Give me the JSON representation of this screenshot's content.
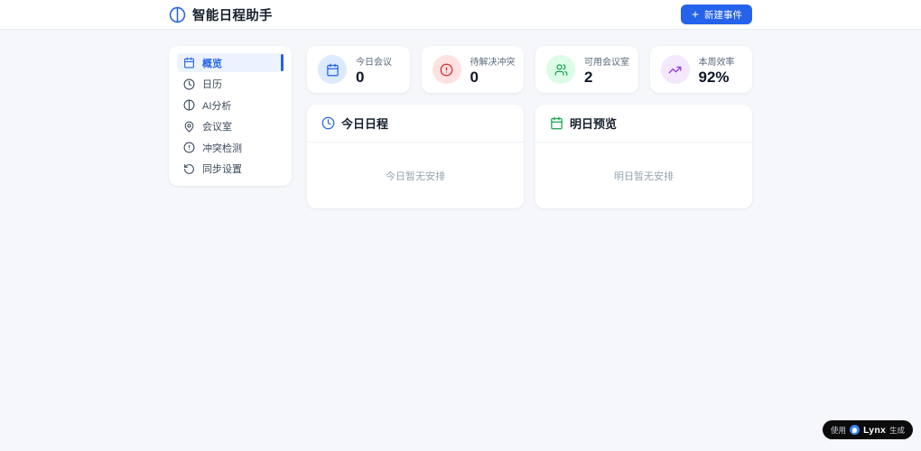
{
  "header": {
    "app_title": "智能日程助手",
    "new_event_button_label": "新建事件"
  },
  "sidebar": {
    "items": [
      {
        "label": "概览",
        "icon": "calendar-icon",
        "active": true
      },
      {
        "label": "日历",
        "icon": "clock-icon",
        "active": false
      },
      {
        "label": "AI分析",
        "icon": "ai-circle-icon",
        "active": false
      },
      {
        "label": "会议室",
        "icon": "map-pin-icon",
        "active": false
      },
      {
        "label": "冲突检测",
        "icon": "alert-circle-icon",
        "active": false
      },
      {
        "label": "同步设置",
        "icon": "sync-icon",
        "active": false
      }
    ]
  },
  "stats": [
    {
      "label": "今日会议",
      "value": "0",
      "icon": "calendar-icon",
      "icon_color": "#2563eb",
      "icon_bg": "#dbeafe"
    },
    {
      "label": "待解决冲突",
      "value": "0",
      "icon": "alert-circle-icon",
      "icon_color": "#dc2626",
      "icon_bg": "#fee2e2"
    },
    {
      "label": "可用会议室",
      "value": "2",
      "icon": "users-icon",
      "icon_color": "#16a34a",
      "icon_bg": "#dcfce7"
    },
    {
      "label": "本周效率",
      "value": "92%",
      "icon": "trending-up-icon",
      "icon_color": "#9333ea",
      "icon_bg": "#f3e8ff"
    }
  ],
  "panels": [
    {
      "title": "今日日程",
      "icon": "clock-icon",
      "icon_color": "#2563eb",
      "empty_text": "今日暂无安排"
    },
    {
      "title": "明日预览",
      "icon": "calendar-icon",
      "icon_color": "#16a34a",
      "empty_text": "明日暂无安排"
    }
  ],
  "footer_badge": {
    "prefix": "使用",
    "brand": "Lynx",
    "suffix": "生成"
  },
  "colors": {
    "accent_blue": "#2563eb",
    "page_background": "#f5f7fa",
    "badge_background": "#0b0b0c",
    "lynx_logo_blue": "#3b82f6"
  }
}
